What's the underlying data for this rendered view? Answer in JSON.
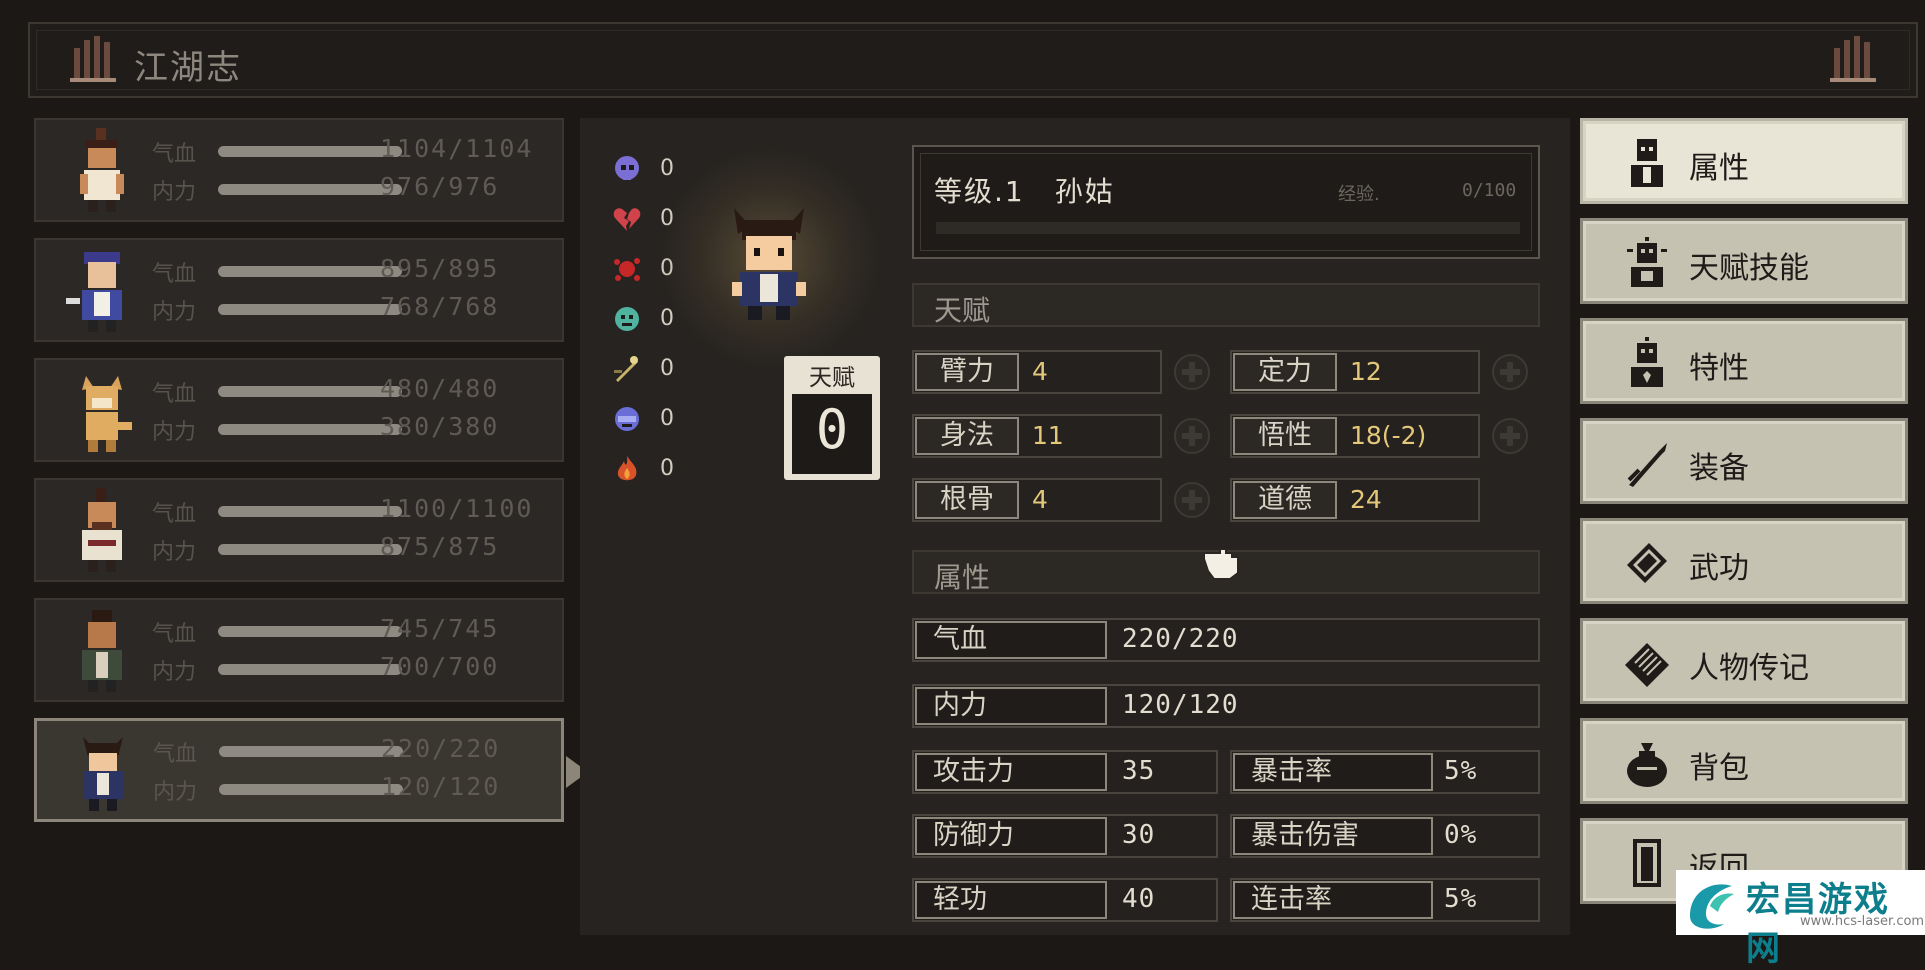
{
  "window": {
    "title": "江湖志"
  },
  "party": [
    {
      "hp_label": "气血",
      "mp_label": "内力",
      "hp": "1104/1104",
      "mp": "976/976",
      "hp_fill": 1.0,
      "mp_fill": 1.0,
      "selected": false
    },
    {
      "hp_label": "气血",
      "mp_label": "内力",
      "hp": "895/895",
      "mp": "768/768",
      "hp_fill": 1.0,
      "mp_fill": 1.0,
      "selected": false
    },
    {
      "hp_label": "气血",
      "mp_label": "内力",
      "hp": "480/480",
      "mp": "380/380",
      "hp_fill": 1.0,
      "mp_fill": 1.0,
      "selected": false
    },
    {
      "hp_label": "气血",
      "mp_label": "内力",
      "hp": "1100/1100",
      "mp": "875/875",
      "hp_fill": 1.0,
      "mp_fill": 1.0,
      "selected": false
    },
    {
      "hp_label": "气血",
      "mp_label": "内力",
      "hp": "745/745",
      "mp": "700/700",
      "hp_fill": 1.0,
      "mp_fill": 1.0,
      "selected": false
    },
    {
      "hp_label": "气血",
      "mp_label": "内力",
      "hp": "220/220",
      "mp": "120/120",
      "hp_fill": 1.0,
      "mp_fill": 1.0,
      "selected": true
    }
  ],
  "status_counts": [
    {
      "icon": "skull-icon",
      "color": "#7b6fd6",
      "value": "0"
    },
    {
      "icon": "broken-heart-icon",
      "color": "#d0434a",
      "value": "0"
    },
    {
      "icon": "blood-splat-icon",
      "color": "#c62828",
      "value": "0"
    },
    {
      "icon": "poison-skull-icon",
      "color": "#4fb3a0",
      "value": "0"
    },
    {
      "icon": "dagger-spark-icon",
      "color": "#c8b46a",
      "value": "0"
    },
    {
      "icon": "frozen-face-icon",
      "color": "#6a6ed6",
      "value": "0"
    },
    {
      "icon": "flame-icon",
      "color": "#d9532a",
      "value": "0"
    }
  ],
  "talent_box": {
    "label": "天赋",
    "value": "0"
  },
  "info": {
    "level_name": "等级.1　孙姑",
    "exp_label": "经验.",
    "exp_value": "0/100",
    "exp_fill": 0
  },
  "talent_section": {
    "title": "天赋"
  },
  "talents": [
    {
      "name": "臂力",
      "value": "4",
      "plus": true
    },
    {
      "name": "定力",
      "value": "12",
      "plus": true
    },
    {
      "name": "身法",
      "value": "11",
      "plus": true
    },
    {
      "name": "悟性",
      "value": "18(-2)",
      "plus": true
    },
    {
      "name": "根骨",
      "value": "4",
      "plus": true
    },
    {
      "name": "道德",
      "value": "24",
      "plus": false
    }
  ],
  "attr_section": {
    "title": "属性"
  },
  "stats_full": [
    {
      "name": "气血",
      "value": "220/220"
    },
    {
      "name": "内力",
      "value": "120/120"
    }
  ],
  "stats_pairs": [
    {
      "left_name": "攻击力",
      "left_value": "35",
      "right_name": "暴击率",
      "right_value": "5%"
    },
    {
      "left_name": "防御力",
      "left_value": "30",
      "right_name": "暴击伤害",
      "right_value": "0%"
    },
    {
      "left_name": "轻功",
      "left_value": "40",
      "right_name": "连击率",
      "right_value": "5%"
    }
  ],
  "menu": [
    {
      "label": "属性",
      "icon": "character-icon",
      "active": true
    },
    {
      "label": "天赋技能",
      "icon": "talent-skill-icon",
      "active": false
    },
    {
      "label": "特性",
      "icon": "trait-icon",
      "active": false
    },
    {
      "label": "装备",
      "icon": "sword-icon",
      "active": false
    },
    {
      "label": "武功",
      "icon": "martial-book-icon",
      "active": false
    },
    {
      "label": "人物传记",
      "icon": "scroll-icon",
      "active": false
    },
    {
      "label": "背包",
      "icon": "bag-icon",
      "active": false
    },
    {
      "label": "返回",
      "icon": "door-icon",
      "active": false
    }
  ],
  "watermark": {
    "title": "宏昌游戏网",
    "url": "www.hcs-laser.com"
  }
}
